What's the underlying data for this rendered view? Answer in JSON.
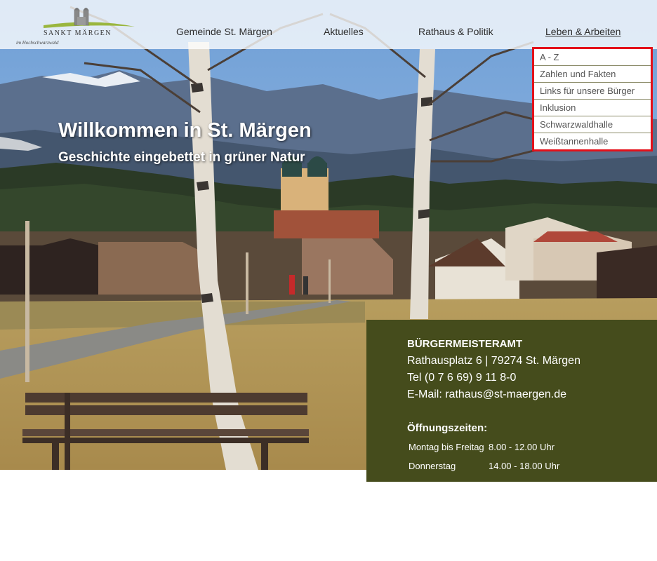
{
  "logo": {
    "name": "SANKT MÄRGEN",
    "tagline": "im Hochschwarzwald"
  },
  "nav": {
    "items": [
      {
        "label": "Gemeinde St. Märgen"
      },
      {
        "label": "Aktuelles"
      },
      {
        "label": "Rathaus & Politik"
      },
      {
        "label": "Leben & Arbeiten"
      }
    ],
    "active": "Leben & Arbeiten"
  },
  "dropdown": {
    "items": [
      {
        "label": "A - Z"
      },
      {
        "label": "Zahlen und Fakten"
      },
      {
        "label": "Links für unsere Bürger"
      },
      {
        "label": "Inklusion"
      },
      {
        "label": "Schwarzwaldhalle"
      },
      {
        "label": "Weißtannenhalle"
      }
    ],
    "highlight_color": "#e3101a"
  },
  "hero": {
    "title": "Willkommen in St. Märgen",
    "subtitle": "Geschichte eingebettet in grüner Natur"
  },
  "contact": {
    "heading": "BÜRGERMEISTERAMT",
    "address": "Rathausplatz 6 | 79274 St. Märgen",
    "phone": "Tel (0 7 6 69) 9 11 8-0",
    "email": "E-Mail: rathaus@st-maergen.de",
    "hours_title": "Öffnungszeiten:",
    "hours": [
      {
        "days": "Montag bis Freitag",
        "time": "8.00 - 12.00 Uhr"
      },
      {
        "days": "Donnerstag",
        "time": "14.00 - 18.00 Uhr"
      }
    ],
    "background_color": "#454c1c"
  }
}
